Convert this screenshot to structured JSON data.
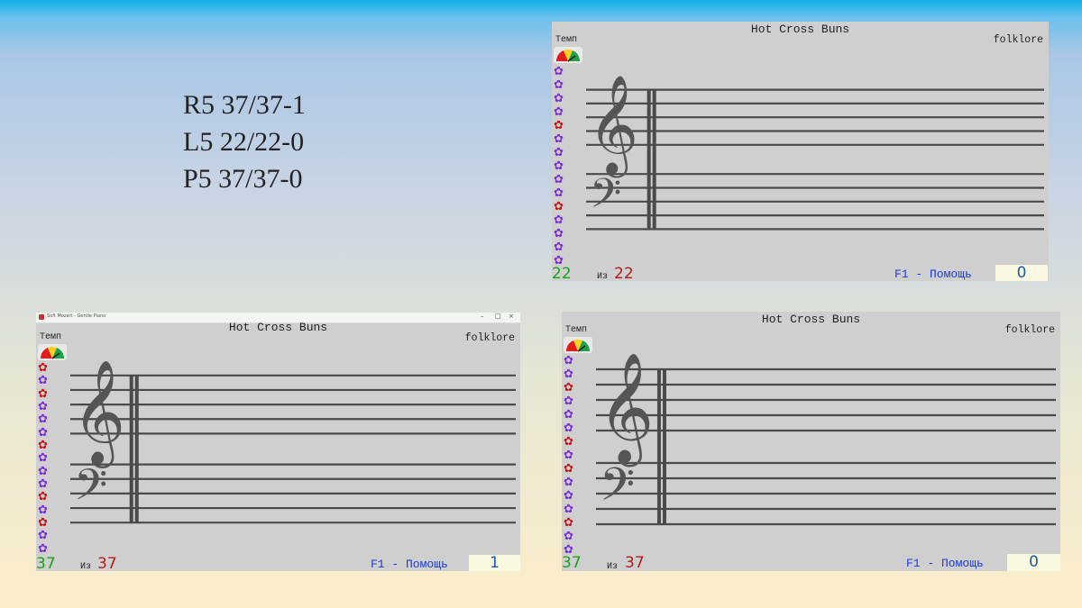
{
  "stats": {
    "lines": [
      "R5 37/37-1",
      "L5 22/22-0",
      "P5 37/37-0"
    ]
  },
  "windows": [
    {
      "id": "top-right",
      "title": "Hot Cross Buns",
      "composer": "folklore",
      "tempo_label": "Темп",
      "count": "22",
      "of_label": "Из",
      "total": "22",
      "help": "F1 - Помощь",
      "errors": "0",
      "flowers": [
        "purple",
        "purple",
        "purple",
        "purple",
        "red",
        "purple",
        "purple",
        "purple",
        "purple",
        "purple",
        "red",
        "purple",
        "purple",
        "purple",
        "purple"
      ]
    },
    {
      "id": "bottom-left",
      "title": "Hot Cross Buns",
      "composer": "folklore",
      "tempo_label": "Темп",
      "count": "37",
      "of_label": "Из",
      "total": "37",
      "help": "F1 - Помощь",
      "errors": "1",
      "app_title": "Soft Mozart - Gentle Piano",
      "flowers": [
        "red",
        "purple",
        "red",
        "purple",
        "purple",
        "purple",
        "red",
        "purple",
        "purple",
        "purple",
        "red",
        "purple",
        "red",
        "purple",
        "purple"
      ]
    },
    {
      "id": "bottom-right",
      "title": "Hot Cross Buns",
      "composer": "folklore",
      "tempo_label": "Темп",
      "count": "37",
      "of_label": "Из",
      "total": "37",
      "help": "F1 - Помощь",
      "errors": "0",
      "flowers": [
        "purple",
        "purple",
        "red",
        "purple",
        "purple",
        "purple",
        "red",
        "purple",
        "red",
        "purple",
        "purple",
        "purple",
        "red",
        "purple",
        "purple"
      ]
    }
  ],
  "colors": {
    "count": "#17a317",
    "total": "#b51919",
    "help": "#1a3ad6",
    "flower_purple": "#7a2fd0",
    "flower_red": "#c01818"
  },
  "icons": {
    "speed": "speedometer-icon",
    "flower": "flower-icon",
    "treble": "treble-clef-icon",
    "bass": "bass-clef-icon"
  }
}
